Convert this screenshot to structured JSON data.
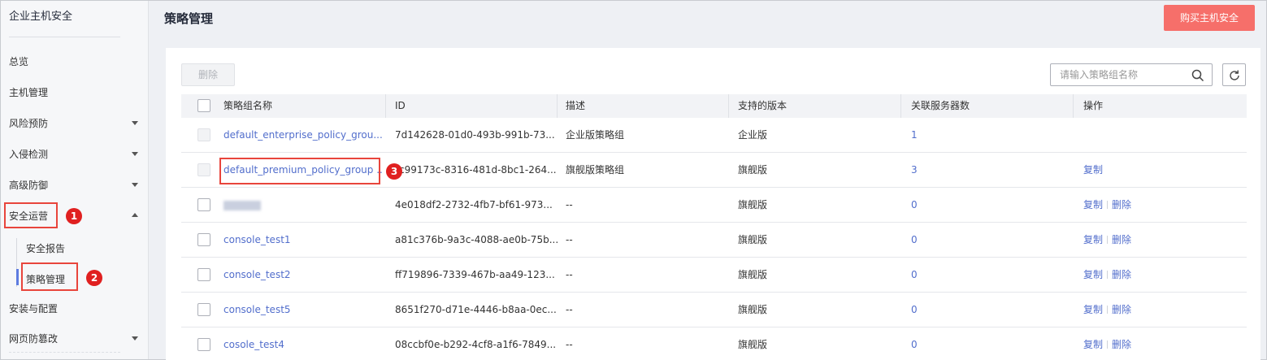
{
  "sidebar": {
    "title": "企业主机安全",
    "items": [
      {
        "label": "总览",
        "caret": ""
      },
      {
        "label": "主机管理",
        "caret": ""
      },
      {
        "label": "风险预防",
        "caret": "down"
      },
      {
        "label": "入侵检测",
        "caret": "down"
      },
      {
        "label": "高级防御",
        "caret": "down"
      },
      {
        "label": "安全运营",
        "caret": "up"
      },
      {
        "label": "安装与配置",
        "caret": ""
      },
      {
        "label": "网页防篡改",
        "caret": "down"
      }
    ],
    "sub_items": [
      {
        "label": "安全报告",
        "active": false
      },
      {
        "label": "策略管理",
        "active": true
      }
    ]
  },
  "header": {
    "title": "策略管理",
    "buy_label": "购买主机安全"
  },
  "toolbar": {
    "delete_label": "删除",
    "search_placeholder": "请输入策略组名称",
    "search_value": ""
  },
  "table": {
    "columns": [
      "策略组名称",
      "ID",
      "描述",
      "支持的版本",
      "关联服务器数",
      "操作"
    ],
    "rows": [
      {
        "name": "default_enterprise_policy_grou...",
        "id": "7d142628-01d0-493b-991b-73...",
        "desc": "企业版策略组",
        "version": "企业版",
        "servers": "1",
        "actions": [],
        "checkbox_disabled": true,
        "name_blurred": false
      },
      {
        "name": "default_premium_policy_group ...",
        "id": "c99173c-8316-481d-8bc1-264...",
        "desc": "旗舰版策略组",
        "version": "旗舰版",
        "servers": "3",
        "actions": [
          "复制"
        ],
        "checkbox_disabled": true,
        "name_blurred": false
      },
      {
        "name": "",
        "id": "4e018df2-2732-4fb7-bf61-973...",
        "desc": "--",
        "version": "旗舰版",
        "servers": "0",
        "actions": [
          "复制",
          "删除"
        ],
        "checkbox_disabled": false,
        "name_blurred": true
      },
      {
        "name": "console_test1",
        "id": "a81c376b-9a3c-4088-ae0b-75b...",
        "desc": "--",
        "version": "旗舰版",
        "servers": "0",
        "actions": [
          "复制",
          "删除"
        ],
        "checkbox_disabled": false,
        "name_blurred": false
      },
      {
        "name": "console_test2",
        "id": "ff719896-7339-467b-aa49-123...",
        "desc": "--",
        "version": "旗舰版",
        "servers": "0",
        "actions": [
          "复制",
          "删除"
        ],
        "checkbox_disabled": false,
        "name_blurred": false
      },
      {
        "name": "console_test5",
        "id": "8651f270-d71e-4446-b8aa-0ec...",
        "desc": "--",
        "version": "旗舰版",
        "servers": "0",
        "actions": [
          "复制",
          "删除"
        ],
        "checkbox_disabled": false,
        "name_blurred": false
      },
      {
        "name": "cosole_test4",
        "id": "08ccbf0e-b292-4cf8-a1f6-7849...",
        "desc": "--",
        "version": "旗舰版",
        "servers": "0",
        "actions": [
          "复制",
          "删除"
        ],
        "checkbox_disabled": false,
        "name_blurred": false
      }
    ]
  },
  "annotations": {
    "steps": [
      "1",
      "2",
      "3"
    ],
    "color": "#e8453c"
  },
  "colors": {
    "link": "#526ecc",
    "buy_button": "#f66f6a",
    "active_indicator": "#5e7ce0"
  }
}
